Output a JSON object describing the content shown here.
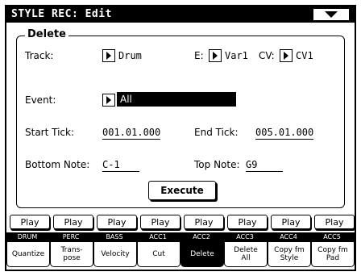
{
  "window": {
    "title": "STYLE REC: Edit",
    "menu_icon": "triangle-down-icon"
  },
  "delete_group": {
    "title": "Delete",
    "track_label": "Track:",
    "track_value": "Drum",
    "e_label": "E:",
    "e_value": "Var1",
    "cv_label": "CV:",
    "cv_value": "CV1",
    "event_label": "Event:",
    "event_value": "All",
    "start_tick_label": "Start Tick:",
    "start_tick_value": "001.01.000",
    "end_tick_label": "End Tick:",
    "end_tick_value": "005.01.000",
    "bottom_note_label": "Bottom Note:",
    "bottom_note_value": "C-1",
    "top_note_label": "Top Note:",
    "top_note_value": "G9",
    "execute_label": "Execute"
  },
  "play_buttons": [
    "Play",
    "Play",
    "Play",
    "Play",
    "Play",
    "Play",
    "Play",
    "Play"
  ],
  "tracks": [
    "DRUM",
    "PERC",
    "BASS",
    "ACC1",
    "ACC2",
    "ACC3",
    "ACC4",
    "ACC5"
  ],
  "tabs": [
    {
      "label": "Quantize",
      "active": false
    },
    {
      "label": "Trans-\npose",
      "active": false
    },
    {
      "label": "Velocity",
      "active": false
    },
    {
      "label": "Cut",
      "active": false
    },
    {
      "label": "Delete",
      "active": true
    },
    {
      "label": "Delete\nAll",
      "active": false
    },
    {
      "label": "Copy fm\nStyle",
      "active": false
    },
    {
      "label": "Copy fm\nPad",
      "active": false
    }
  ]
}
